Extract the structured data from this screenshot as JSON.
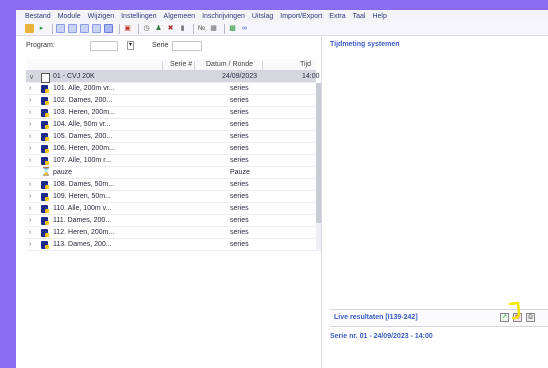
{
  "menu": [
    "Bestand",
    "Module",
    "Wijzigen",
    "Instellingen",
    "Algemeen",
    "Inschrijvingen",
    "Uitslag",
    "Import/Export",
    "Extra",
    "Taal",
    "Help"
  ],
  "filters": {
    "program_label": "Program:",
    "serie_label": "Serie"
  },
  "grid": {
    "columns": [
      "Serie #",
      "Datum / Ronde",
      "Tijd"
    ],
    "group": {
      "label": "01 - CVJ 20K",
      "date": "24/09/2023",
      "time": "14:00"
    },
    "rows": [
      {
        "name": "101. Alle, 200m vr...",
        "type": "series",
        "kind": "race"
      },
      {
        "name": "102. Dames, 200...",
        "type": "series",
        "kind": "race"
      },
      {
        "name": "103. Heren, 200m...",
        "type": "series",
        "kind": "race"
      },
      {
        "name": "104. Alle, 50m vr...",
        "type": "series",
        "kind": "race"
      },
      {
        "name": "105. Dames, 200...",
        "type": "series",
        "kind": "race"
      },
      {
        "name": "106. Heren, 200m...",
        "type": "series",
        "kind": "race"
      },
      {
        "name": "107. Alle, 100m r...",
        "type": "series",
        "kind": "race"
      },
      {
        "name": "pauze",
        "type": "Pauze",
        "kind": "pause"
      },
      {
        "name": "108. Dames, 50m...",
        "type": "series",
        "kind": "race"
      },
      {
        "name": "109. Heren, 50m...",
        "type": "series",
        "kind": "race"
      },
      {
        "name": "110. Alle, 100m v...",
        "type": "series",
        "kind": "race"
      },
      {
        "name": "111. Dames, 200...",
        "type": "series",
        "kind": "race"
      },
      {
        "name": "112. Heren, 200m...",
        "type": "series",
        "kind": "race"
      },
      {
        "name": "113. Dames, 200...",
        "type": "series",
        "kind": "race"
      }
    ]
  },
  "right": {
    "timing_title": "Tijdmeting systemen",
    "live_title": "Live resultaten [I139-242]",
    "serie_info": "Serie nr. 01 - 24/09/2023 - 14:00"
  },
  "icons": {
    "toolbar": [
      "folder-icon",
      "arrow-icon",
      "grid-icon",
      "grid-icon",
      "grid-icon",
      "grid-icon",
      "grid-icon",
      "gift-icon",
      "clock-icon",
      "people-icon",
      "tools-icon",
      "chart-icon",
      "number-icon",
      "lock-icon",
      "doc-icon",
      "link-icon"
    ],
    "live": [
      "export-icon",
      "globe-icon",
      "print-icon"
    ]
  },
  "colors": {
    "accent": "#3b5cc6",
    "background": "#8a6cf0",
    "group_row": "#d6d6de",
    "highlight": "#f2e600"
  }
}
